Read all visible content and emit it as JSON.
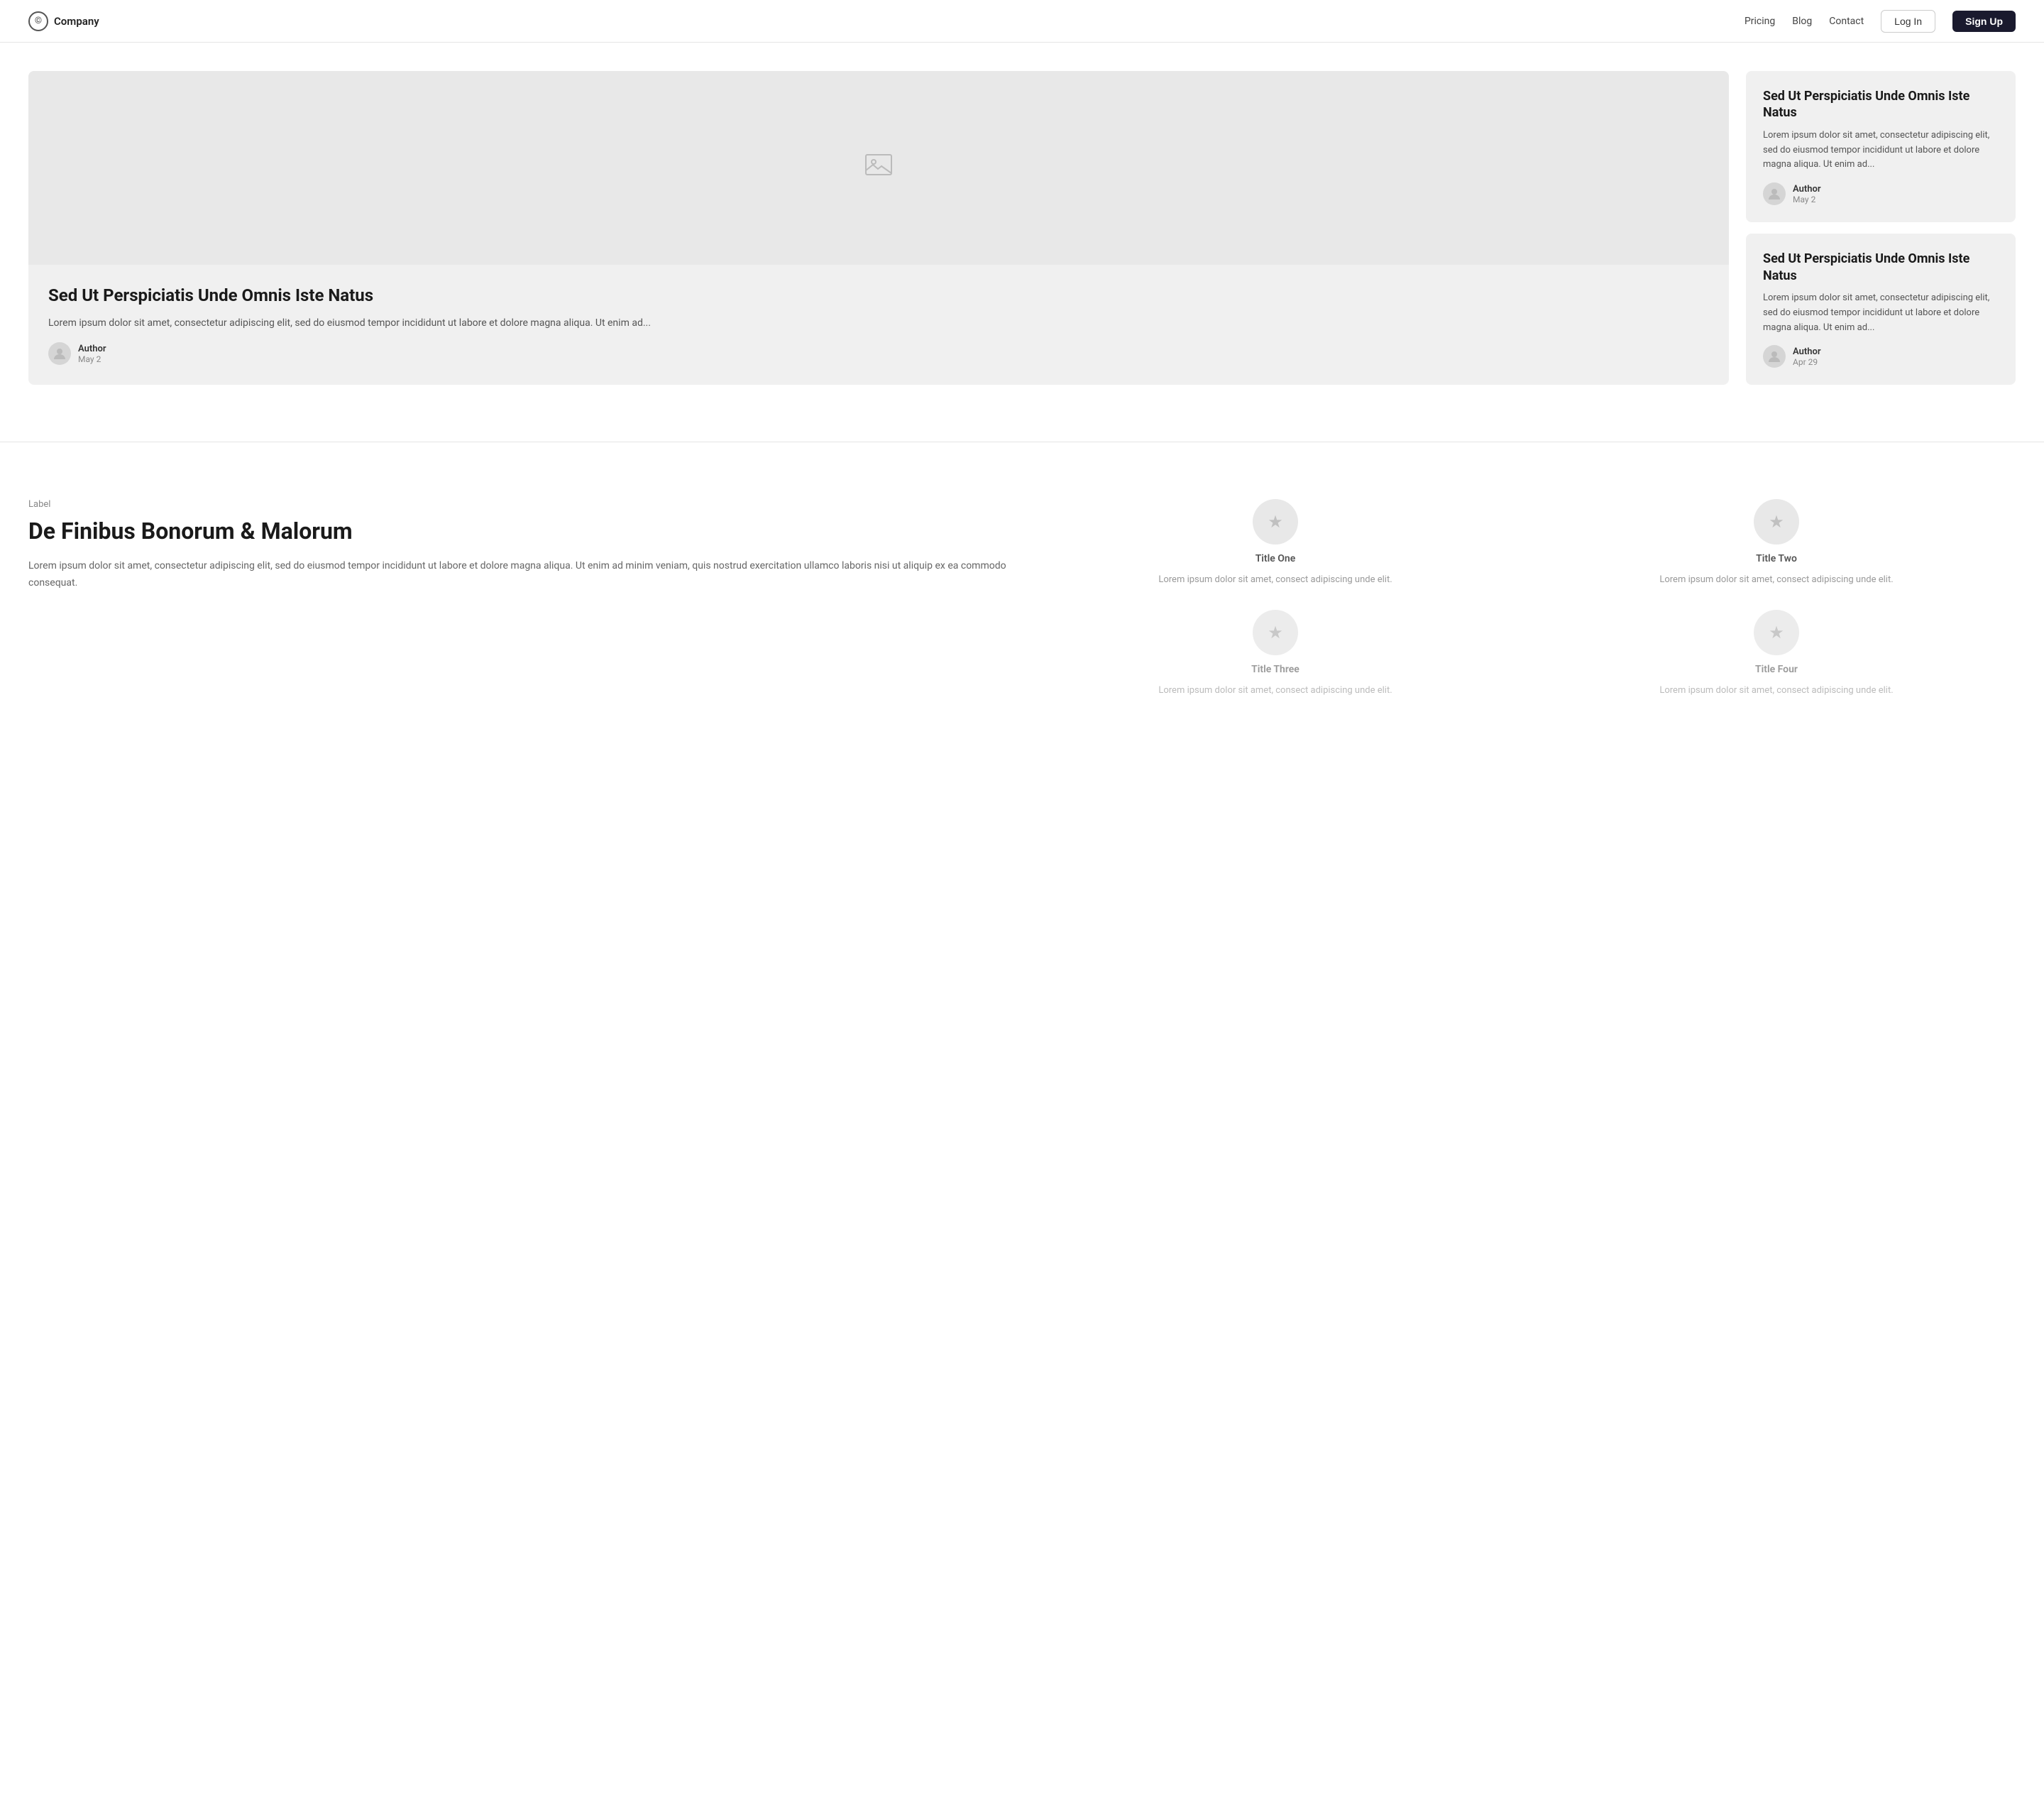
{
  "nav": {
    "brand_icon": "©",
    "brand_name": "Company",
    "links": [
      "Pricing",
      "Blog",
      "Contact"
    ],
    "login_label": "Log In",
    "signup_label": "Sign Up"
  },
  "featured": {
    "title": "Sed Ut Perspiciatis Unde Omnis Iste Natus",
    "excerpt": "Lorem ipsum dolor sit amet, consectetur adipiscing elit, sed do eiusmod tempor incididunt ut labore et dolore magna aliqua. Ut enim ad...",
    "author": "Author",
    "date": "May 2"
  },
  "sidebar_cards": [
    {
      "title": "Sed Ut Perspiciatis Unde Omnis Iste Natus",
      "excerpt": "Lorem ipsum dolor sit amet, consectetur adipiscing elit, sed do eiusmod tempor incididunt ut labore et dolore magna aliqua. Ut enim ad...",
      "author": "Author",
      "date": "May 2"
    },
    {
      "title": "Sed Ut Perspiciatis Unde Omnis Iste Natus",
      "excerpt": "Lorem ipsum dolor sit amet, consectetur adipiscing elit, sed do eiusmod tempor incididunt ut labore et dolore magna aliqua. Ut enim ad...",
      "author": "Author",
      "date": "Apr 29"
    }
  ],
  "features_section": {
    "label": "Label",
    "title": "De Finibus Bonorum & Malorum",
    "description": "Lorem ipsum dolor sit amet, consectetur adipiscing elit, sed do eiusmod tempor incididunt ut labore et dolore magna aliqua. Ut enim ad minim veniam, quis nostrud exercitation ullamco laboris nisi ut aliquip ex ea commodo consequat.",
    "items": [
      {
        "title": "Title One",
        "description": "Lorem ipsum dolor sit amet, consect adipiscing unde elit.",
        "icon": "★"
      },
      {
        "title": "Title Two",
        "description": "Lorem ipsum dolor sit amet, consect adipiscing unde elit.",
        "icon": "★"
      },
      {
        "title": "Title Three",
        "description": "Lorem ipsum dolor sit amet, consect adipiscing unde elit.",
        "icon": "★"
      },
      {
        "title": "Title Four",
        "description": "Lorem ipsum dolor sit amet, consect adipiscing unde elit.",
        "icon": "★"
      }
    ]
  }
}
